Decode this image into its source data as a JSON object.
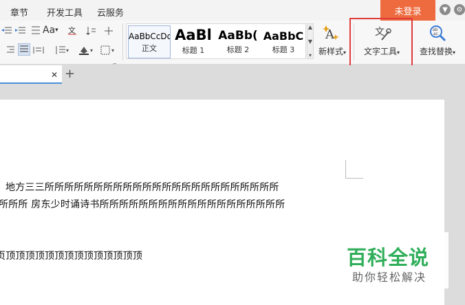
{
  "menubar": {
    "items": [
      "章节",
      "开发工具",
      "云服务"
    ],
    "login": "未登录"
  },
  "ribbon": {
    "styles": [
      {
        "preview": "AaBbCcDd",
        "label": "正文"
      },
      {
        "preview": "AaBl",
        "label": "标题 1"
      },
      {
        "preview": "AaBb(",
        "label": "标题 2"
      },
      {
        "preview": "AaBbC",
        "label": "标题 3"
      }
    ],
    "new_style": "新样式",
    "text_tools": "文字工具",
    "find_replace": "查找替换"
  },
  "document": {
    "lines": [
      "地方三三所所所所所所所所所所所所所所所所所所所所所所所所",
      "所所所  房东少时诵诗书所所所所所所所所所所所所所所所所所所所",
      "页顶顶顶顶顶顶顶顶顶顶顶顶顶顶"
    ]
  },
  "watermark": {
    "title": "百科全说",
    "subtitle": "助你轻松解决"
  },
  "colors": {
    "accent": "#ee6b3f",
    "highlight": "#e03a3a",
    "watermark_green": "#2fae5a"
  }
}
